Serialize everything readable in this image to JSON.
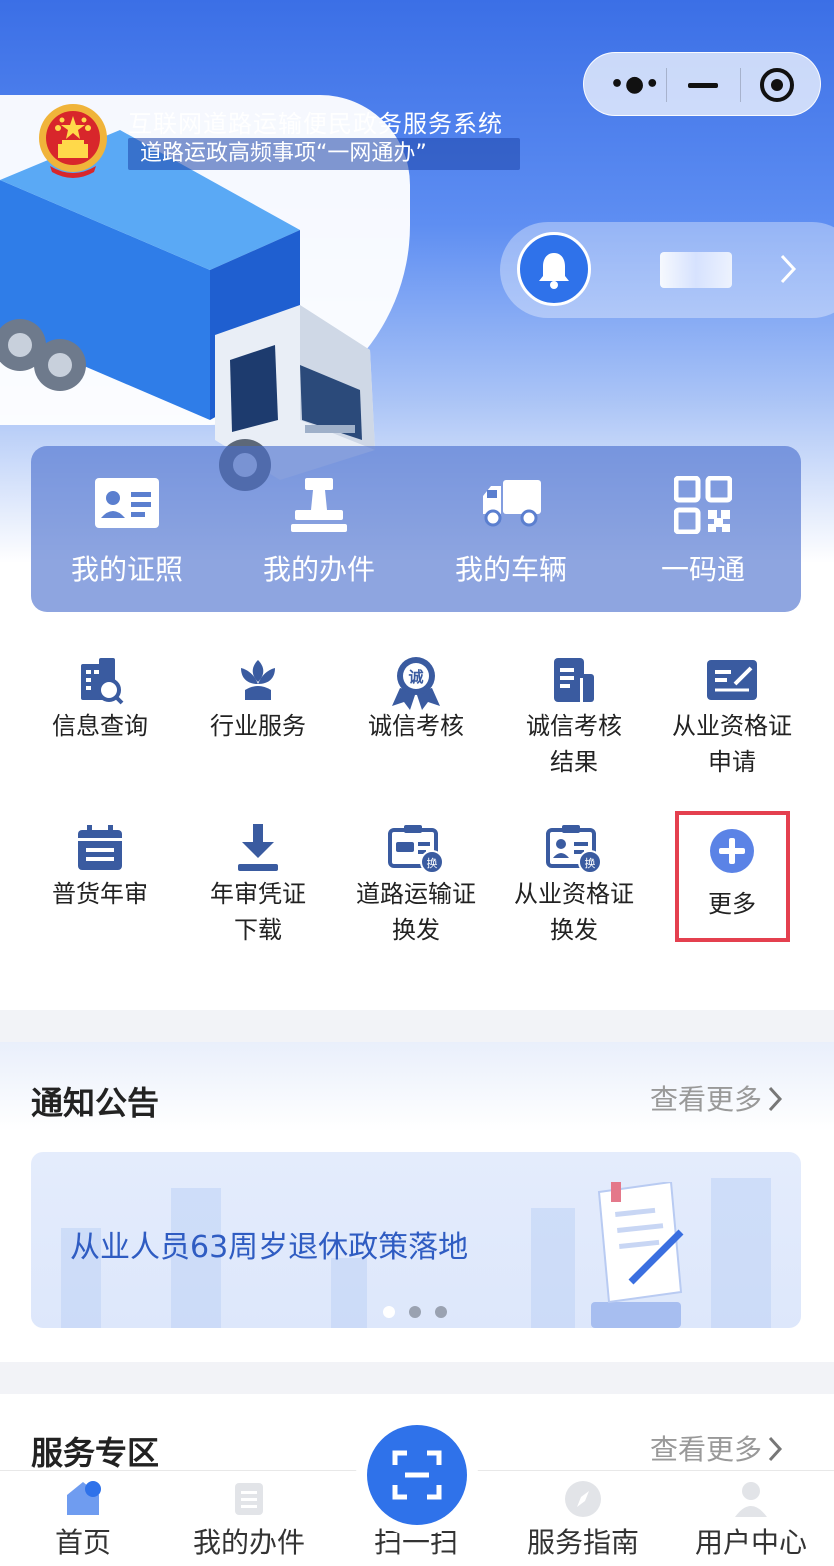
{
  "header": {
    "system_title": "互联网道路运输便民政务服务系统",
    "system_subtitle": "道路运政高频事项“一网通办”"
  },
  "capsule": {
    "more_icon": "more-dots-icon",
    "minimize_icon": "minimize-icon",
    "close_icon": "target-close-icon"
  },
  "quick_bar": {
    "items": [
      {
        "label": "我的证照",
        "icon": "license-card-icon"
      },
      {
        "label": "我的办件",
        "icon": "stamp-icon"
      },
      {
        "label": "我的车辆",
        "icon": "truck-icon"
      },
      {
        "label": "一码通",
        "icon": "qr-code-icon"
      }
    ]
  },
  "services": {
    "row1": [
      {
        "label": "信息查询",
        "icon": "building-search-icon"
      },
      {
        "label": "行业服务",
        "icon": "lotus-icon"
      },
      {
        "label": "诚信考核",
        "icon": "credit-badge-icon",
        "badge_text": "诚"
      },
      {
        "label": "诚信考核\n结果",
        "line1": "诚信考核",
        "line2": "结果",
        "icon": "document-icon"
      },
      {
        "line1": "从业资格证",
        "line2": "申请",
        "icon": "sign-card-icon"
      }
    ],
    "row2": [
      {
        "label": "普货年审",
        "icon": "calendar-icon"
      },
      {
        "line1": "年审凭证",
        "line2": "下载",
        "icon": "download-icon"
      },
      {
        "line1": "道路运输证",
        "line2": "换发",
        "icon": "vehicle-card-exchange-icon",
        "badge_text": "换"
      },
      {
        "line1": "从业资格证",
        "line2": "换发",
        "icon": "person-card-exchange-icon",
        "badge_text": "换"
      },
      {
        "label": "更多",
        "icon": "plus-circle-icon"
      }
    ]
  },
  "notice": {
    "title": "通知公告",
    "see_more": "查看更多",
    "banner_text": "从业人员63周岁退休政策落地",
    "carousel_count": 3,
    "carousel_active": 1
  },
  "service_zone": {
    "title": "服务专区",
    "see_more": "查看更多"
  },
  "tabbar": {
    "items": [
      {
        "label": "首页",
        "icon": "home-icon",
        "active": true
      },
      {
        "label": "我的办件",
        "icon": "files-icon",
        "active": false
      },
      {
        "label": "扫一扫",
        "icon": "scan-icon",
        "active": false
      },
      {
        "label": "服务指南",
        "icon": "compass-icon",
        "active": false
      },
      {
        "label": "用户中心",
        "icon": "user-icon",
        "active": false
      }
    ]
  },
  "colors": {
    "primary": "#2f72ea",
    "icon_navy": "#3a5ba0",
    "highlight_red": "#e4404f"
  }
}
